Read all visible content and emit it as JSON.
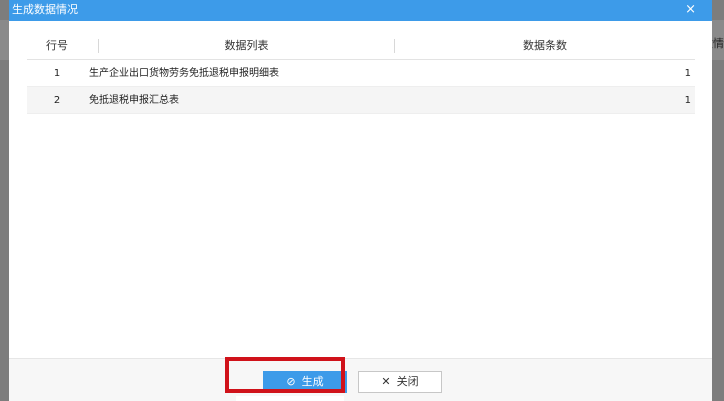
{
  "background": {
    "right_edge_text": "收情"
  },
  "dialog": {
    "title": "生成数据情况",
    "close_glyph": "×",
    "table": {
      "columns": [
        "行号",
        "数据列表",
        "数据条数"
      ],
      "rows": [
        {
          "num": "1",
          "name": "生产企业出口货物劳务免抵退税申报明细表",
          "count": "1"
        },
        {
          "num": "2",
          "name": "免抵退税申报汇总表",
          "count": "1"
        }
      ]
    },
    "footer": {
      "generate_icon": "⊘",
      "generate_label": "生成",
      "close_icon": "✕",
      "close_label": "关闭"
    }
  },
  "colors": {
    "primary": "#3d9be9",
    "highlight": "#d0121a"
  }
}
